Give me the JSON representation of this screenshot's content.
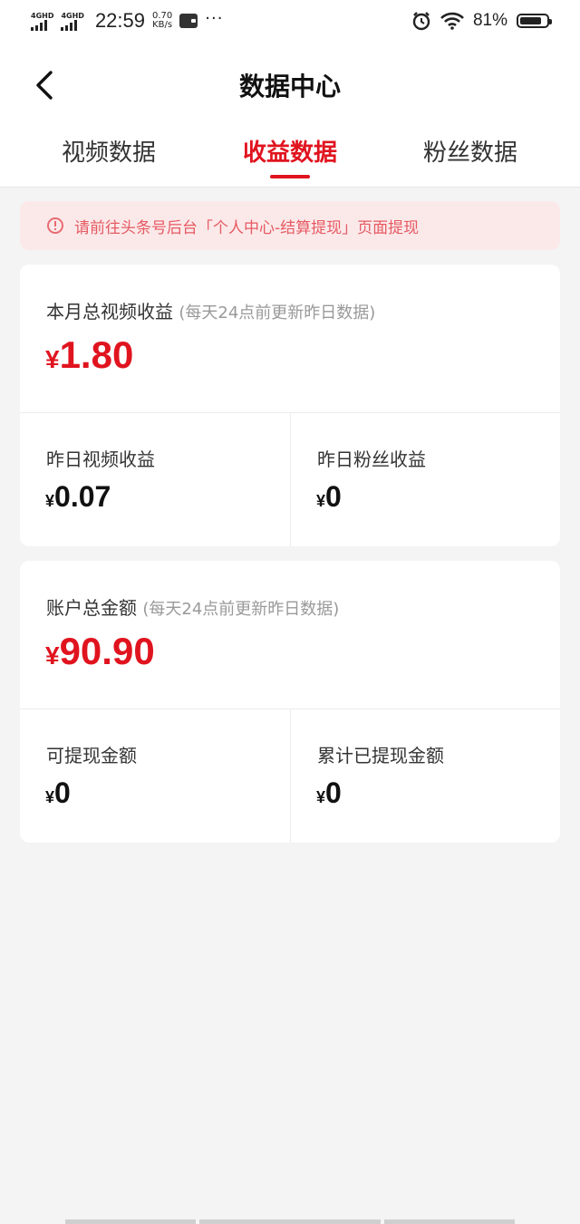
{
  "status_bar": {
    "network_1": "4GHD",
    "network_2": "4GHD",
    "time": "22:59",
    "speed_value": "0.70",
    "speed_unit": "KB/s",
    "more": "···",
    "battery_percent": "81%",
    "battery_level": 0.81
  },
  "header": {
    "title": "数据中心",
    "back_icon": "chevron-left-icon"
  },
  "tabs": [
    {
      "label": "视频数据",
      "active": false
    },
    {
      "label": "收益数据",
      "active": true
    },
    {
      "label": "粉丝数据",
      "active": false
    }
  ],
  "notice": {
    "icon": "alert-circle-icon",
    "text": "请前往头条号后台「个人中心-结算提现」页面提现"
  },
  "income_card": {
    "label": "本月总视频收益",
    "hint": "(每天24点前更新昨日数据)",
    "currency": "¥",
    "value": "1.80",
    "cells": [
      {
        "label": "昨日视频收益",
        "currency": "¥",
        "value": "0.07"
      },
      {
        "label": "昨日粉丝收益",
        "currency": "¥",
        "value": "0"
      }
    ]
  },
  "account_card": {
    "label": "账户总金额",
    "hint": "(每天24点前更新昨日数据)",
    "currency": "¥",
    "value": "90.90",
    "cells": [
      {
        "label": "可提现金额",
        "currency": "¥",
        "value": "0"
      },
      {
        "label": "累计已提现金额",
        "currency": "¥",
        "value": "0"
      }
    ]
  },
  "colors": {
    "accent": "#e0141f",
    "notice_bg": "#fbe9ea",
    "page_bg": "#f4f4f4"
  }
}
